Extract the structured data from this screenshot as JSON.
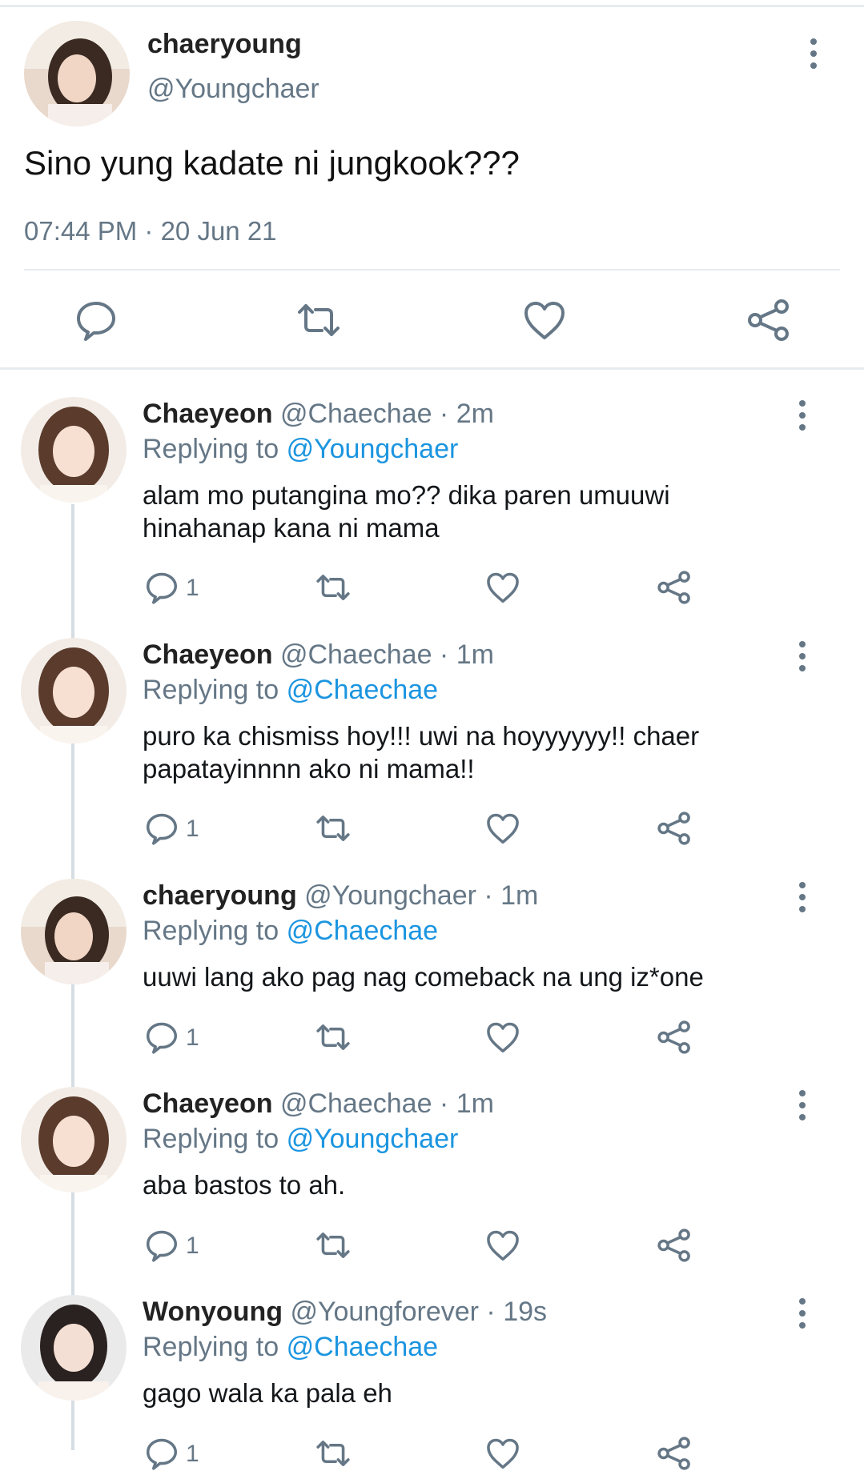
{
  "main_tweet": {
    "display_name": "chaeryoung",
    "handle": "@Youngchaer",
    "text": "Sino yung kadate ni jungkook???",
    "timestamp": "07:44 PM · 20 Jun 21",
    "avatar_icon": "avatar-photo"
  },
  "replies": [
    {
      "display_name": "Chaeyeon",
      "handle_time": "@Chaechae · 2m",
      "replying_prefix": "Replying to",
      "replying_to": "@Youngchaer",
      "text_line1": "alam mo putangina mo?? dika paren umuuwi",
      "text_line2": "hinahanap kana ni mama",
      "reply_count": "1"
    },
    {
      "display_name": "Chaeyeon",
      "handle_time": "@Chaechae · 1m",
      "replying_prefix": "Replying to",
      "replying_to": "@Chaechae",
      "text_line1": "puro ka chismiss hoy!!! uwi na hoyyyyyy!! chaer",
      "text_line2": "papatayinnnn ako ni mama!!",
      "reply_count": "1"
    },
    {
      "display_name": "chaeryoung",
      "handle_time": "@Youngchaer · 1m",
      "replying_prefix": "Replying to",
      "replying_to": "@Chaechae",
      "text_line1": "uuwi lang ako pag nag comeback na ung iz*one",
      "text_line2": "",
      "reply_count": "1"
    },
    {
      "display_name": "Chaeyeon",
      "handle_time": "@Chaechae · 1m",
      "replying_prefix": "Replying to",
      "replying_to": "@Youngchaer",
      "text_line1": "aba bastos to ah.",
      "text_line2": "",
      "reply_count": "1"
    },
    {
      "display_name": "Wonyoung",
      "handle_time": "@Youngforever · 19s",
      "replying_prefix": "Replying to",
      "replying_to": "@Chaechae",
      "text_line1": "gago wala ka pala eh",
      "text_line2": "",
      "reply_count": "1"
    }
  ],
  "colors": {
    "link": "#1b95e0",
    "muted": "#657786",
    "divider": "#e6ecf0"
  }
}
